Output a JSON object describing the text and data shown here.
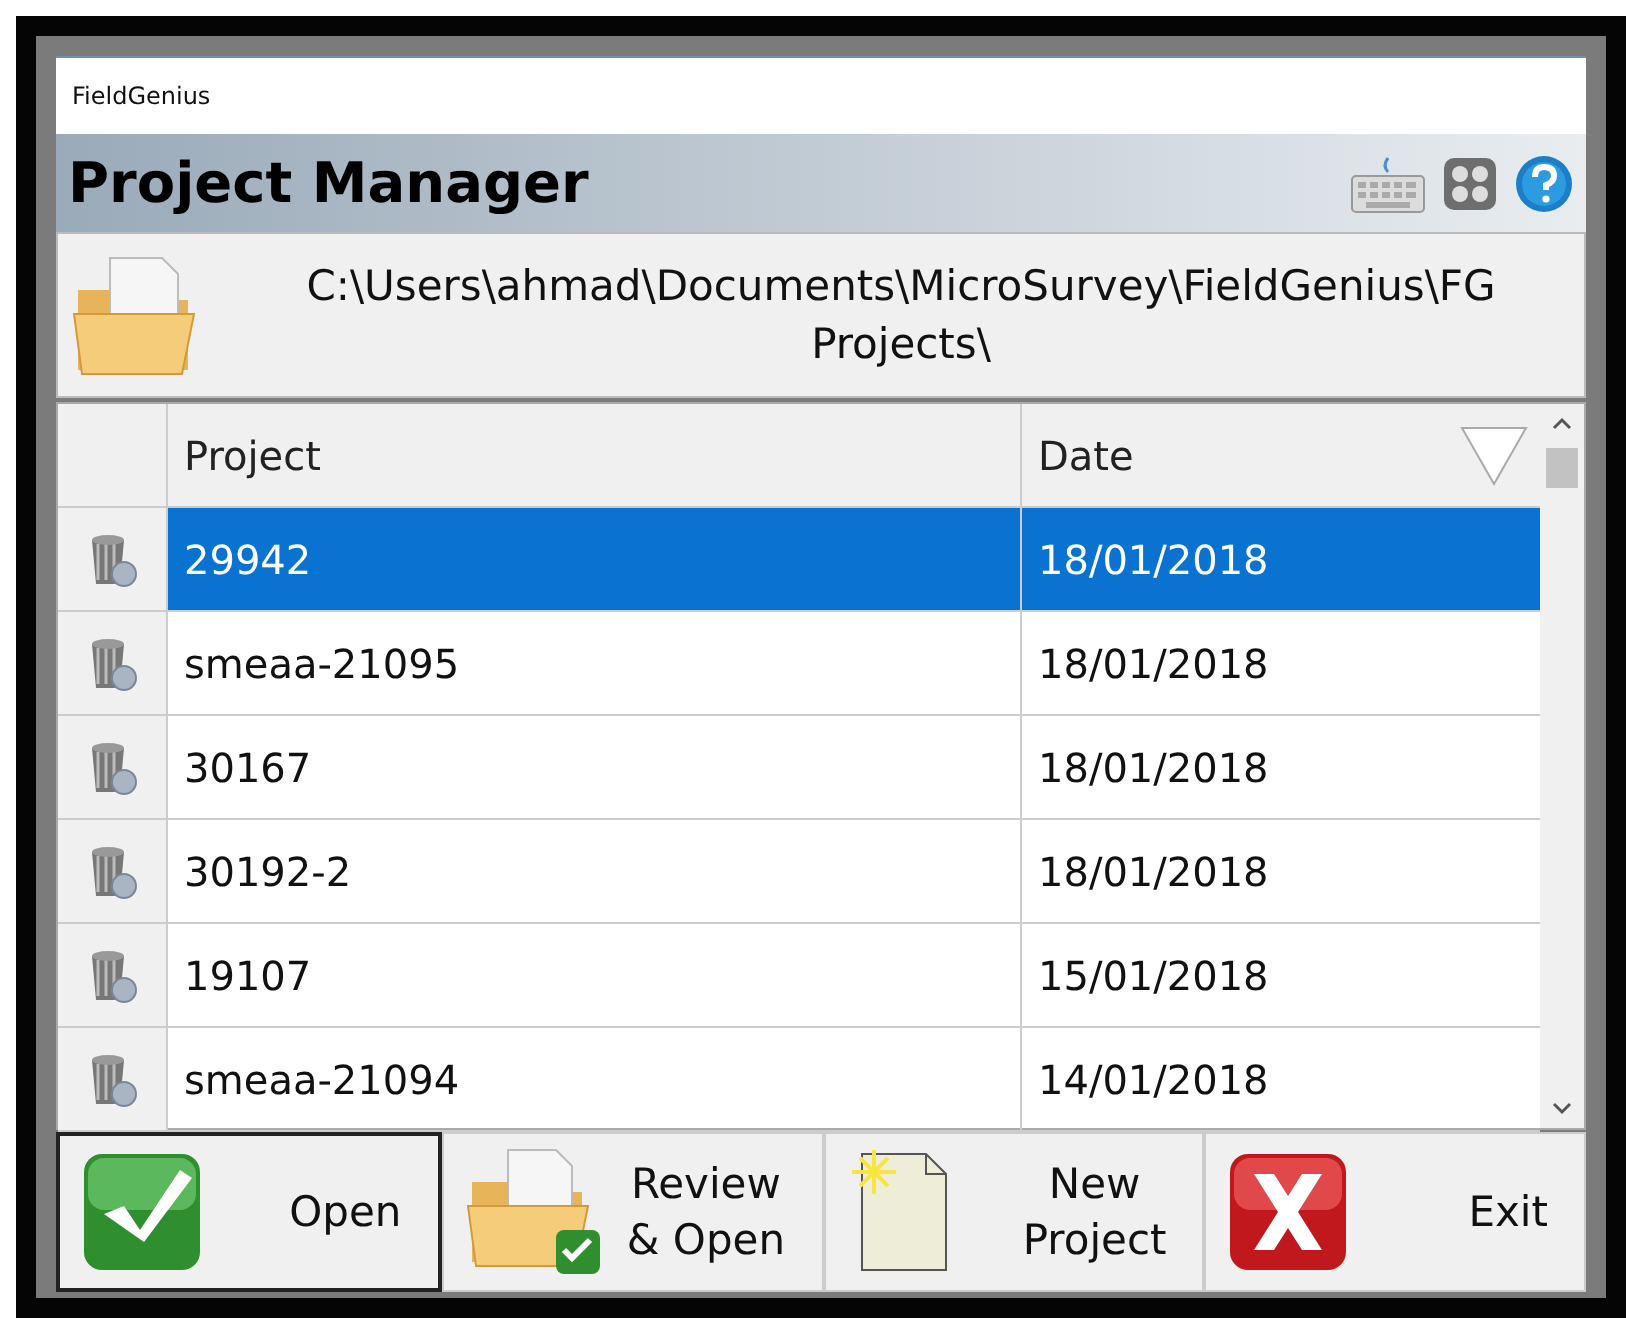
{
  "window": {
    "title": "FieldGenius"
  },
  "header": {
    "title": "Project Manager"
  },
  "path": {
    "text": "C:\\Users\\ahmad\\Documents\\MicroSurvey\\FieldGenius\\FG Projects\\"
  },
  "table": {
    "columns": [
      {
        "label": "Project"
      },
      {
        "label": "Date",
        "sorted": true
      }
    ],
    "rows": [
      {
        "project": "29942",
        "date": "18/01/2018",
        "selected": true
      },
      {
        "project": "smeaa-21095",
        "date": "18/01/2018",
        "selected": false
      },
      {
        "project": "30167",
        "date": "18/01/2018",
        "selected": false
      },
      {
        "project": "30192-2",
        "date": "18/01/2018",
        "selected": false
      },
      {
        "project": "19107",
        "date": "15/01/2018",
        "selected": false
      },
      {
        "project": "smeaa-21094",
        "date": "14/01/2018",
        "selected": false
      }
    ]
  },
  "buttons": [
    {
      "kind": "open",
      "lines": [
        "Open"
      ],
      "focused": true
    },
    {
      "kind": "review",
      "lines": [
        "Review",
        "& Open"
      ],
      "focused": false
    },
    {
      "kind": "new",
      "lines": [
        "New",
        "Project"
      ],
      "focused": false
    },
    {
      "kind": "exit",
      "lines": [
        "Exit"
      ],
      "focused": false
    }
  ]
}
